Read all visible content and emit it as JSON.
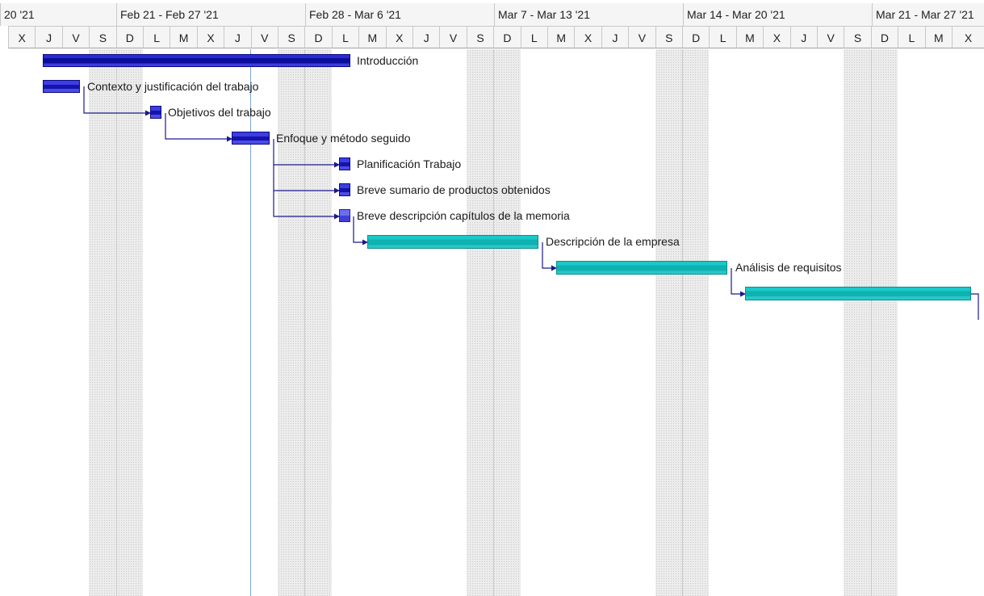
{
  "timeline": {
    "week_labels": [
      "20 '21",
      "Feb 21 - Feb 27 '21",
      "Feb 28 - Mar 6 '21",
      "Mar 7 - Mar 13 '21",
      "Mar 14 - Mar 20 '21",
      "Mar 21 - Mar 27 '21"
    ],
    "day_labels": [
      "X",
      "J",
      "V",
      "S",
      "D",
      "L",
      "M",
      "X",
      "J",
      "V",
      "S",
      "D",
      "L",
      "M",
      "X",
      "J",
      "V",
      "S",
      "D",
      "L",
      "M",
      "X",
      "J",
      "V",
      "S",
      "D",
      "L",
      "M",
      "X",
      "J",
      "V",
      "S",
      "D",
      "L",
      "M",
      "X"
    ]
  },
  "tasks": [
    {
      "name": "Introducción"
    },
    {
      "name": "Contexto y justificación del trabajo"
    },
    {
      "name": "Objetivos del trabajo"
    },
    {
      "name": "Enfoque y método seguido"
    },
    {
      "name": "Planificación Trabajo"
    },
    {
      "name": "Breve sumario de productos obtenidos"
    },
    {
      "name": "Breve descripción capítulos de la memoria"
    },
    {
      "name": "Descripción de la empresa"
    },
    {
      "name": "Análisis de requisitos"
    },
    {
      "name": ""
    }
  ],
  "colors": {
    "summary": "#0d0d9c",
    "task_done": "#1414aa",
    "task_partial": "#4040d8",
    "task_pending": "#0fb1b1",
    "link": "#1a1a8a",
    "today_line": "#7aa7d6"
  }
}
